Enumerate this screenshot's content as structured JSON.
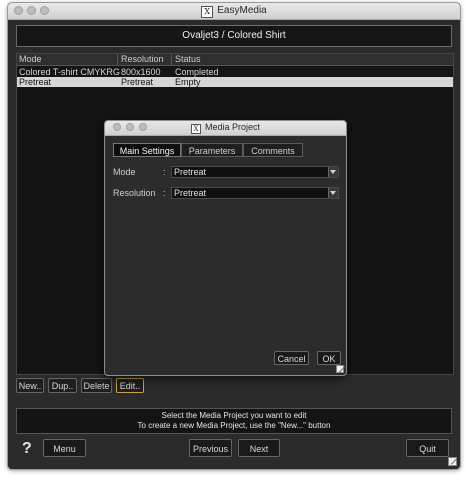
{
  "window": {
    "title": "EasyMedia",
    "banner": "Ovaljet3 / Colored Shirt"
  },
  "table": {
    "columns": [
      "Mode",
      "Resolution",
      "Status"
    ],
    "rows": [
      {
        "mode": "Colored T-shirt CMYKRG",
        "resolution": "800x1600",
        "status": "Completed"
      },
      {
        "mode": "Pretreat",
        "resolution": "Pretreat",
        "status": "Empty"
      }
    ],
    "selected_row": 1
  },
  "row_buttons": {
    "new": "New..",
    "dup": "Dup..",
    "delete": "Delete",
    "edit": "Edit.."
  },
  "status": {
    "line1": "Select the Media Project you want to edit",
    "line2": "To create a new Media Project, use the \"New...\" button"
  },
  "footer": {
    "help": "?",
    "menu": "Menu",
    "previous": "Previous",
    "next": "Next",
    "quit": "Quit"
  },
  "dialog": {
    "title": "Media Project",
    "tabs": [
      "Main Settings",
      "Parameters",
      "Comments"
    ],
    "active_tab": 0,
    "fields": {
      "mode_label": "Mode",
      "mode_value": "Pretreat",
      "resolution_label": "Resolution",
      "resolution_value": "Pretreat"
    },
    "cancel": "Cancel",
    "ok": "OK"
  },
  "icons": {
    "logo": "X",
    "traffic_lights": [
      "close",
      "minimize",
      "zoom"
    ]
  },
  "colors": {
    "background": "#2b2b2b",
    "selection": "#d6d6d6",
    "focus_border": "#c8a24a"
  }
}
